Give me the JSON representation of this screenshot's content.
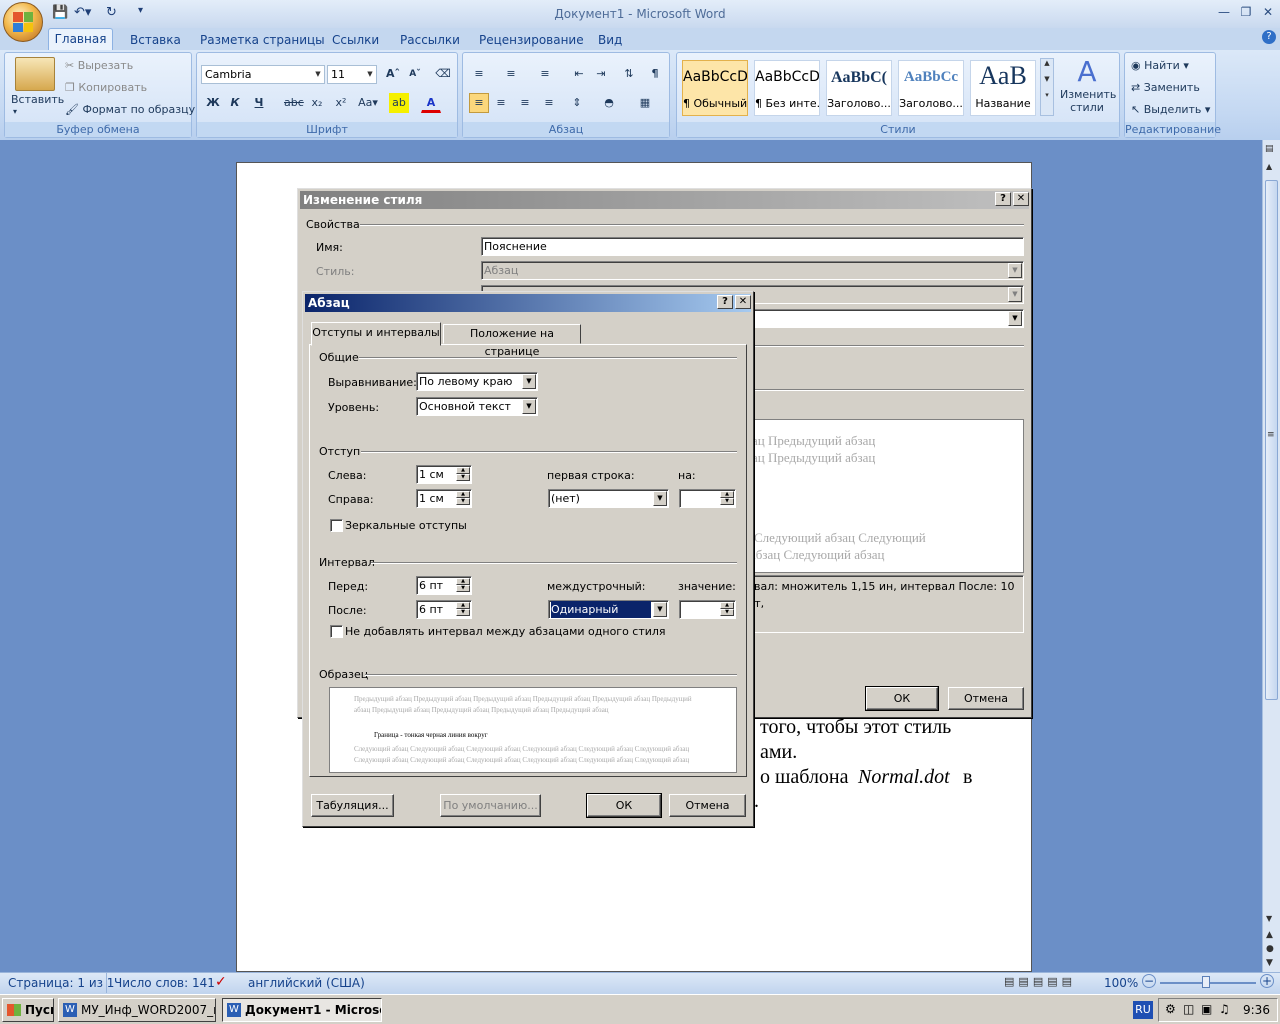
{
  "window": {
    "title": "Документ1 - Microsoft Word"
  },
  "ribbon": {
    "tabs": [
      "Главная",
      "Вставка",
      "Разметка страницы",
      "Ссылки",
      "Рассылки",
      "Рецензирование",
      "Вид"
    ],
    "clipboard": {
      "label": "Буфер обмена",
      "paste": "Вставить",
      "cut": "Вырезать",
      "copy": "Копировать",
      "format_painter": "Формат по образцу"
    },
    "font": {
      "label": "Шрифт",
      "name": "Cambria",
      "size": "11"
    },
    "paragraph": {
      "label": "Абзац"
    },
    "styles": {
      "label": "Стили",
      "items": [
        {
          "preview": "AaBbCcD",
          "name": "¶ Обычный"
        },
        {
          "preview": "AaBbCcD",
          "name": "¶ Без инте..."
        },
        {
          "preview": "AaBbC(",
          "name": "Заголово..."
        },
        {
          "preview": "AaBbCc",
          "name": "Заголово..."
        },
        {
          "preview": "AaB",
          "name": "Название"
        }
      ],
      "change": "Изменить стили"
    },
    "editing": {
      "label": "Редактирование",
      "find": "Найти",
      "replace": "Заменить",
      "select": "Выделить"
    }
  },
  "document": {
    "lines": [
      "того, чтобы этот стиль",
      "ами.",
      "о шаблона",
      "Normal.dot",
      "в",
      "."
    ]
  },
  "modify_style": {
    "title": "Изменение стиля",
    "properties": "Свойства",
    "name_label": "Имя:",
    "name_value": "Пояснение",
    "style_label": "Стиль:",
    "style_value": "Абзац",
    "preview_lines": [
      "ац Предыдущий абзац",
      "ац Предыдущий абзац",
      "Следующий абзац Следующий",
      "абзац Следующий абзац"
    ],
    "description": "рвал:  множитель 1,15 ин, интервал После:  10 пт,",
    "ok": "ОК",
    "cancel": "Отмена"
  },
  "paragraph_dialog": {
    "title": "Абзац",
    "tabs": [
      "Отступы и интервалы",
      "Положение на странице"
    ],
    "general": "Общие",
    "alignment_label": "Выравнивание:",
    "alignment_value": "По левому краю",
    "level_label": "Уровень:",
    "level_value": "Основной текст",
    "indent": "Отступ",
    "left_label": "Слева:",
    "left_value": "1 см",
    "right_label": "Справа:",
    "right_value": "1 см",
    "first_line_label": "первая строка:",
    "first_line_value": "(нет)",
    "by_label": "на:",
    "mirror_label": "Зеркальные отступы",
    "spacing": "Интервал",
    "before_label": "Перед:",
    "before_value": "6 пт",
    "after_label": "После:",
    "after_value": "6 пт",
    "line_spacing_label": "междустрочный:",
    "line_spacing_value": "Одинарный",
    "value_label": "значение:",
    "no_space_label": "Не добавлять интервал между абзацами одного стиля",
    "sample": "Образец",
    "sample_prev": "Предыдущий абзац Предыдущий абзац Предыдущий абзац Предыдущий абзац Предыдущий абзац",
    "sample_cur": "Граница - тонкая черная линия вокруг",
    "sample_next": "Следующий абзац Следующий абзац Следующий абзац Следующий абзац Следующий абзац Следующий абзац",
    "tabs_button": "Табуляция...",
    "default_button": "По умолчанию...",
    "ok": "ОК",
    "cancel": "Отмена"
  },
  "status": {
    "page": "Страница: 1 из 1",
    "words": "Число слов: 141",
    "lang": "английский (США)",
    "zoom": "100%"
  },
  "taskbar": {
    "start": "Пуск",
    "items": [
      "МУ_Инф_WORD2007_в...",
      "Документ1 - Microso..."
    ],
    "lang": "RU",
    "time": "9:36"
  }
}
